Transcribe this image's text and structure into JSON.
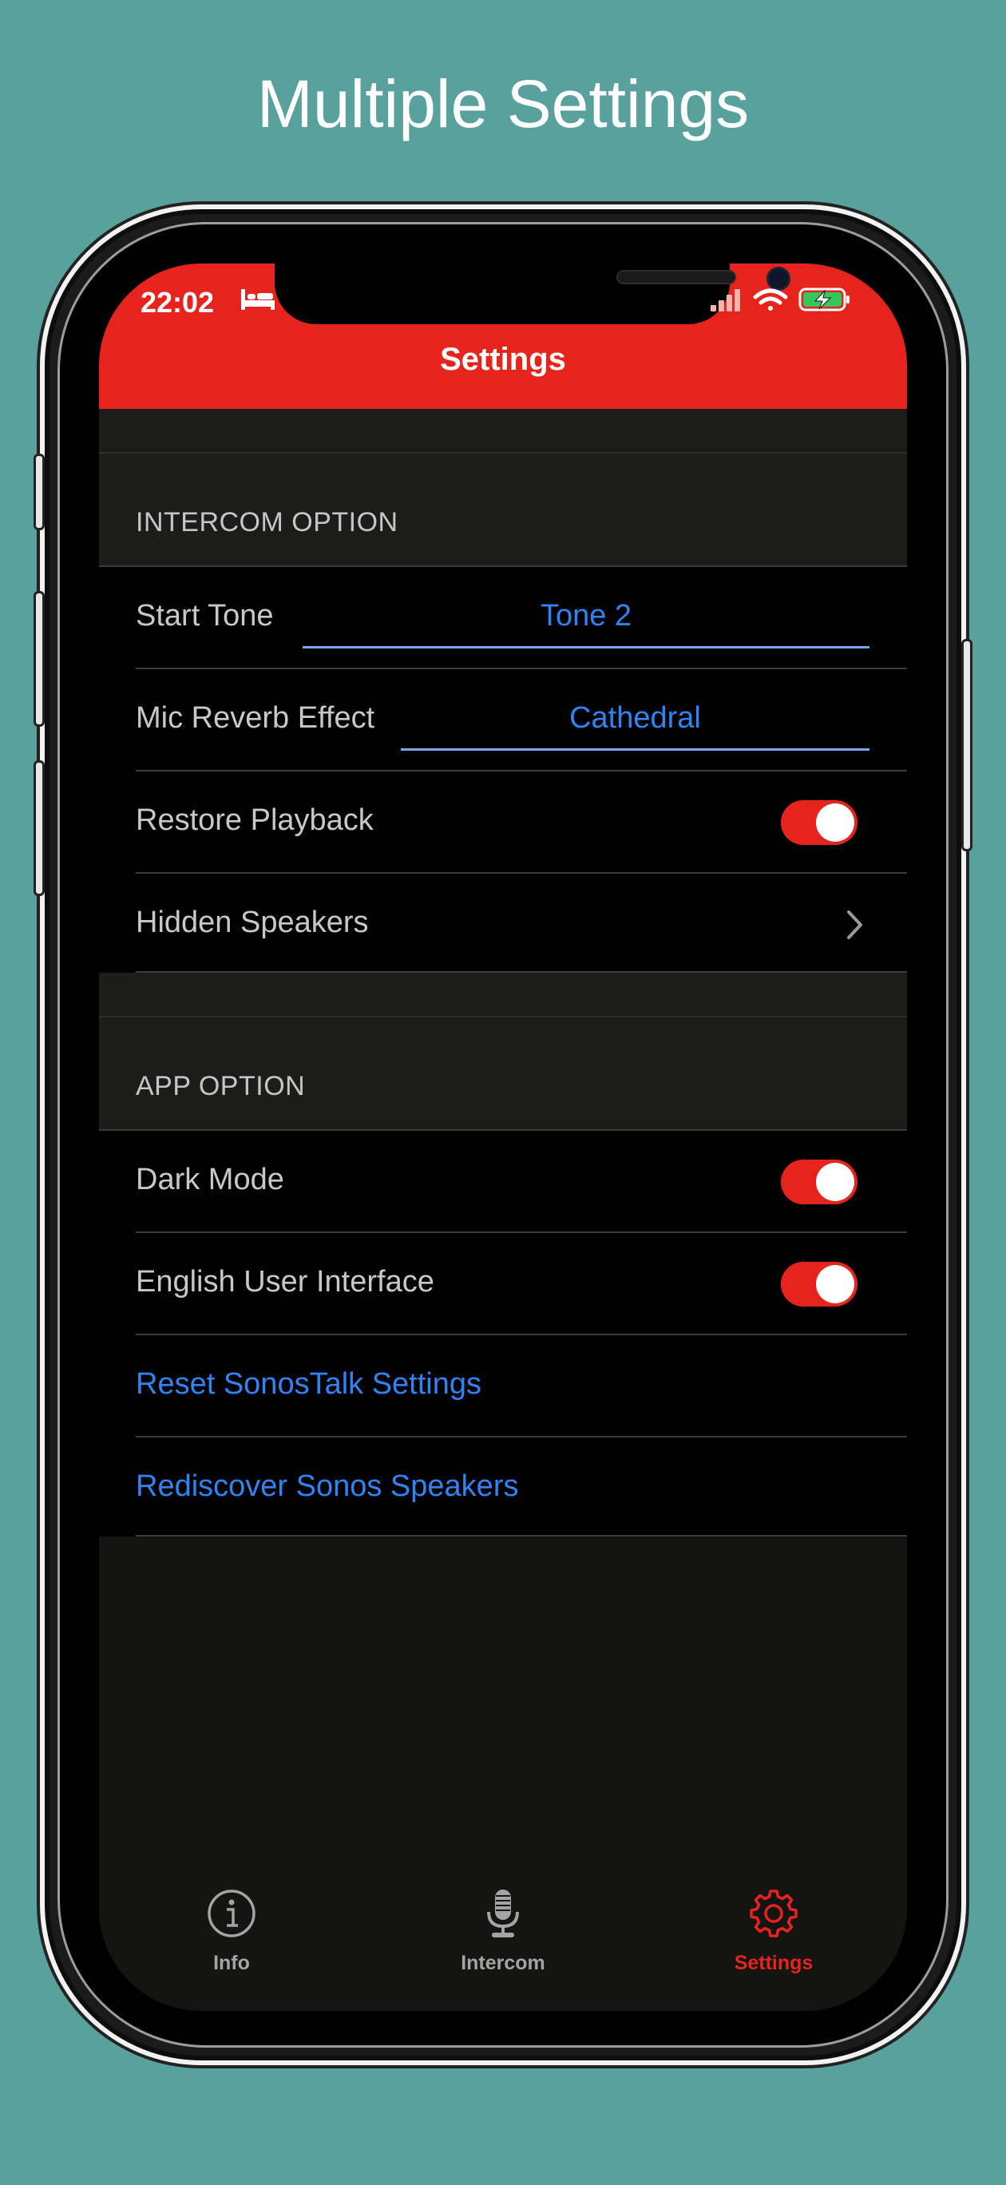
{
  "headline": "Multiple Settings",
  "status_bar": {
    "time": "22:02"
  },
  "nav": {
    "title": "Settings"
  },
  "sections": {
    "intercom": {
      "header": "INTERCOM OPTION",
      "start_tone": {
        "label": "Start Tone",
        "value": "Tone 2"
      },
      "mic_reverb": {
        "label": "Mic Reverb Effect",
        "value": "Cathedral"
      },
      "restore_playback": {
        "label": "Restore Playback",
        "on": true
      },
      "hidden_speakers": {
        "label": "Hidden Speakers"
      }
    },
    "app": {
      "header": "APP OPTION",
      "dark_mode": {
        "label": "Dark Mode",
        "on": true
      },
      "english_ui": {
        "label": "English User Interface",
        "on": true
      },
      "reset": {
        "label": "Reset SonosTalk Settings"
      },
      "rediscover": {
        "label": "Rediscover Sonos Speakers"
      }
    }
  },
  "tabs": {
    "info": {
      "label": "Info",
      "icon": "info-icon"
    },
    "intercom": {
      "label": "Intercom",
      "icon": "microphone-icon"
    },
    "settings": {
      "label": "Settings",
      "icon": "gear-icon",
      "active": true
    }
  },
  "colors": {
    "accent": "#e6231c",
    "link": "#2f84f5",
    "background": "#58a19d",
    "inactive_tab": "#a4a4a4"
  }
}
